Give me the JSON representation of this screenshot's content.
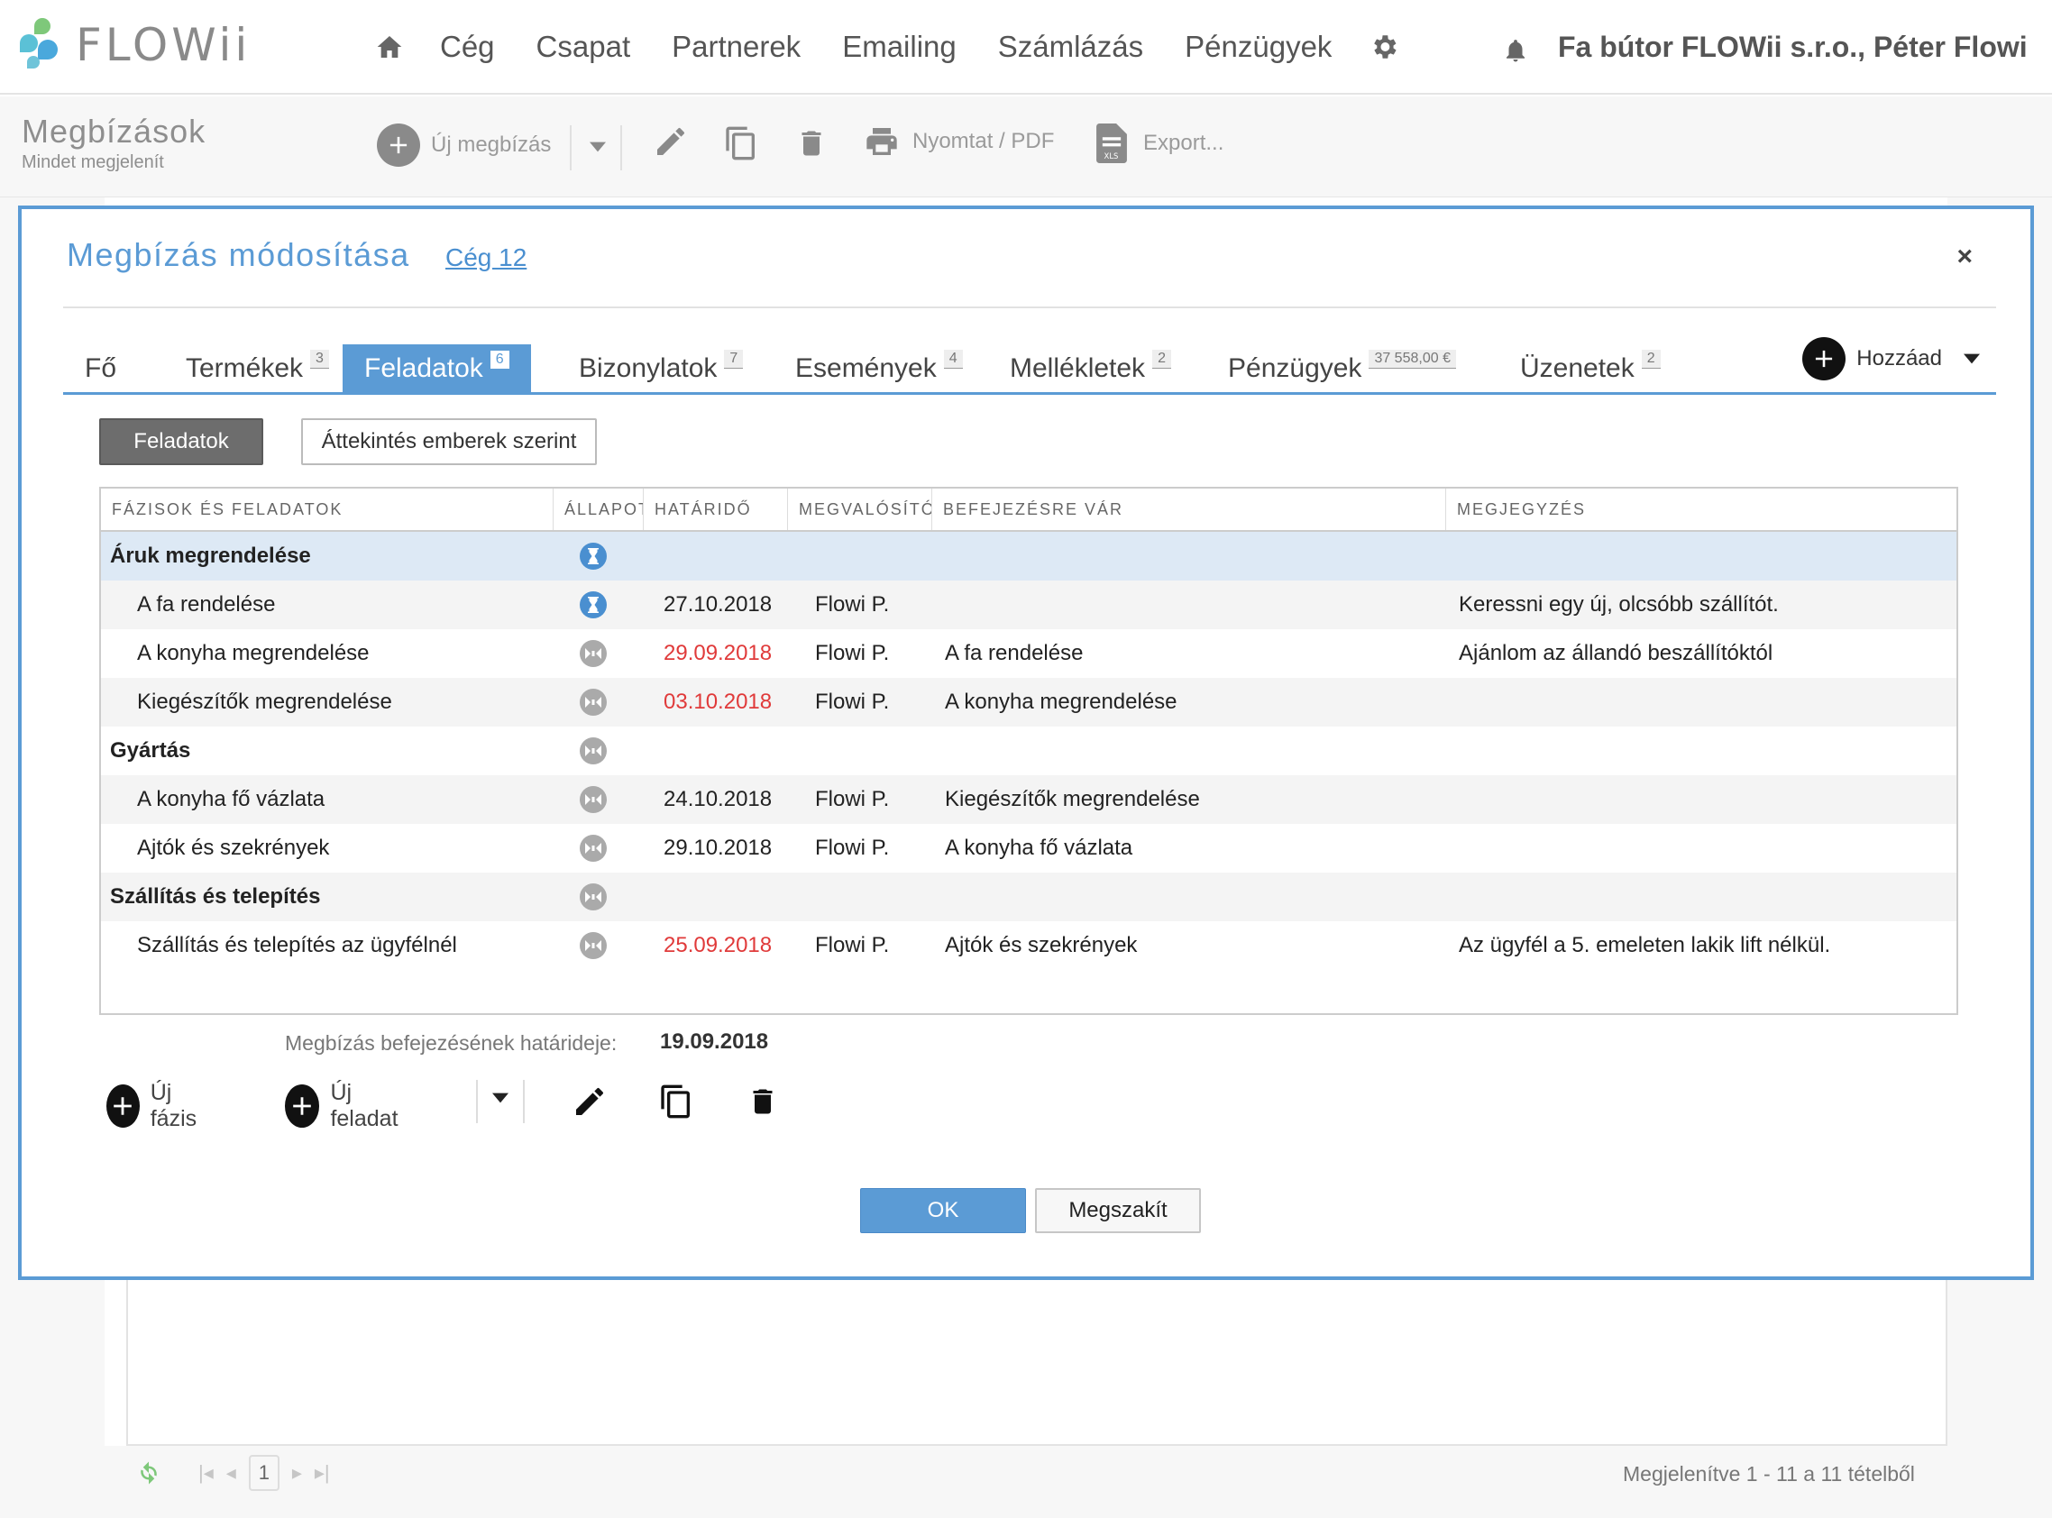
{
  "app": {
    "logo_text": "FLOWii"
  },
  "nav": {
    "items": [
      "Cég",
      "Csapat",
      "Partnerek",
      "Emailing",
      "Számlázás",
      "Pénzügyek"
    ],
    "user": "Fa bútor FLOWii s.r.o., Péter Flowi"
  },
  "toolbar": {
    "title": "Megbízások",
    "subtitle": "Mindet megjelenít",
    "new_label": "Új megbízás",
    "print_label": "Nyomtat / PDF",
    "export_label": "Export..."
  },
  "dialog": {
    "title": "Megbízás módosítása",
    "company_link": "Cég 12",
    "close": "×",
    "tabs": [
      {
        "label": "Fő",
        "badge": ""
      },
      {
        "label": "Termékek",
        "badge": "3"
      },
      {
        "label": "Feladatok",
        "badge": "6"
      },
      {
        "label": "Bizonylatok",
        "badge": "7"
      },
      {
        "label": "Események",
        "badge": "4"
      },
      {
        "label": "Mellékletek",
        "badge": "2"
      },
      {
        "label": "Pénzügyek",
        "badge": "37 558,00 €"
      },
      {
        "label": "Üzenetek",
        "badge": "2"
      }
    ],
    "add_label": "Hozzáad",
    "segments": {
      "tasks": "Feladatok",
      "overview": "Áttekintés emberek szerint"
    },
    "grid": {
      "headers": [
        "FÁZISOK ÉS FELADATOK",
        "ÁLLAPOT",
        "HATÁRIDŐ",
        "MEGVALÓSÍTÓ",
        "BEFEJEZÉSRE VÁR",
        "MEGJEGYZÉS"
      ],
      "rows": [
        {
          "type": "phase",
          "name": "Áruk megrendelése",
          "status": "in-progress",
          "deadline": "",
          "late": false,
          "assignee": "",
          "waits_for": "",
          "note": ""
        },
        {
          "type": "task",
          "name": "A fa rendelése",
          "status": "in-progress",
          "deadline": "27.10.2018",
          "late": false,
          "assignee": "Flowi P.",
          "waits_for": "",
          "note": "Keressni egy új, olcsóbb szállítót."
        },
        {
          "type": "task",
          "name": "A konyha megrendelése",
          "status": "waiting",
          "deadline": "29.09.2018",
          "late": true,
          "assignee": "Flowi P.",
          "waits_for": "A fa rendelése",
          "note": "Ajánlom az állandó beszállítóktól"
        },
        {
          "type": "task",
          "name": "Kiegészítők megrendelése",
          "status": "waiting",
          "deadline": "03.10.2018",
          "late": true,
          "assignee": "Flowi P.",
          "waits_for": "A konyha megrendelése",
          "note": ""
        },
        {
          "type": "phase",
          "name": "Gyártás",
          "status": "waiting",
          "deadline": "",
          "late": false,
          "assignee": "",
          "waits_for": "",
          "note": ""
        },
        {
          "type": "task",
          "name": "A konyha fő vázlata",
          "status": "waiting",
          "deadline": "24.10.2018",
          "late": false,
          "assignee": "Flowi P.",
          "waits_for": "Kiegészítők megrendelése",
          "note": ""
        },
        {
          "type": "task",
          "name": "Ajtók és szekrények",
          "status": "waiting",
          "deadline": "29.10.2018",
          "late": false,
          "assignee": "Flowi P.",
          "waits_for": "A konyha fő vázlata",
          "note": ""
        },
        {
          "type": "phase",
          "name": "Szállítás és telepítés",
          "status": "waiting",
          "deadline": "",
          "late": false,
          "assignee": "",
          "waits_for": "",
          "note": ""
        },
        {
          "type": "task",
          "name": "Szállítás és telepítés az ügyfélnél",
          "status": "waiting",
          "deadline": "25.09.2018",
          "late": true,
          "assignee": "Flowi P.",
          "waits_for": "Ajtók és szekrények",
          "note": "Az ügyfél a 5. emeleten lakik lift nélkül."
        }
      ]
    },
    "deadline_label": "Megbízás befejezésének határideje:",
    "deadline_value": "19.09.2018",
    "actions": {
      "new_phase": "Új fázis",
      "new_task": "Új feladat"
    },
    "ok": "OK",
    "cancel": "Megszakít"
  },
  "pager": {
    "page": "1",
    "info": "Megjelenítve 1 - 11 a 11 tételből"
  },
  "colors": {
    "accent": "#5b9bd5",
    "late": "#e03a3a",
    "status_active": "#4a8fd0",
    "status_waiting": "#aaaaaa"
  }
}
